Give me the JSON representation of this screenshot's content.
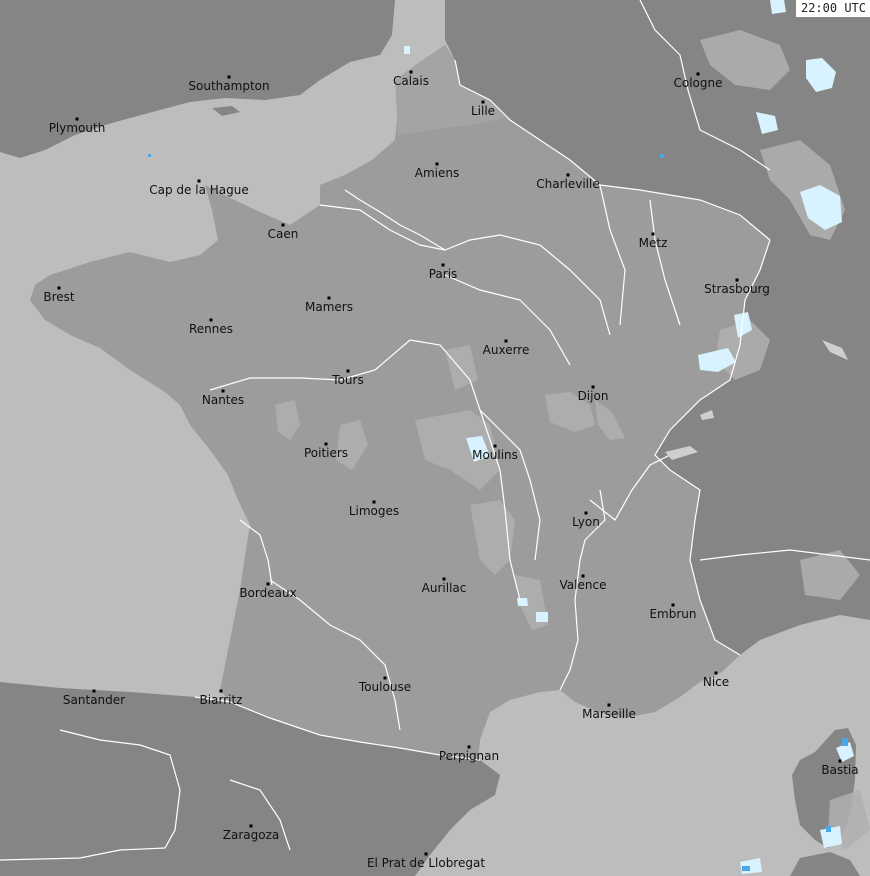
{
  "map": {
    "timestamp": "22:00 UTC",
    "colors": {
      "sea": "#bdbdbd",
      "france": "#9c9c9c",
      "neighbors": "#858585",
      "borders": "#ffffff",
      "cloud_light": "#b0b0b0",
      "precip_light": "#d8f2ff",
      "precip_medium": "#4aa8e8"
    },
    "cities": [
      {
        "name": "Southampton"
      },
      {
        "name": "Calais"
      },
      {
        "name": "Cologne"
      },
      {
        "name": "Plymouth"
      },
      {
        "name": "Lille"
      },
      {
        "name": "Cap de la Hague"
      },
      {
        "name": "Amiens"
      },
      {
        "name": "Charleville"
      },
      {
        "name": "Caen"
      },
      {
        "name": "Metz"
      },
      {
        "name": "Paris"
      },
      {
        "name": "Brest"
      },
      {
        "name": "Strasbourg"
      },
      {
        "name": "Mamers"
      },
      {
        "name": "Rennes"
      },
      {
        "name": "Auxerre"
      },
      {
        "name": "Tours"
      },
      {
        "name": "Dijon"
      },
      {
        "name": "Nantes"
      },
      {
        "name": "Poitiers"
      },
      {
        "name": "Moulins"
      },
      {
        "name": "Limoges"
      },
      {
        "name": "Lyon"
      },
      {
        "name": "Aurillac"
      },
      {
        "name": "Valence"
      },
      {
        "name": "Bordeaux"
      },
      {
        "name": "Embrun"
      },
      {
        "name": "Nice"
      },
      {
        "name": "Toulouse"
      },
      {
        "name": "Santander"
      },
      {
        "name": "Biarritz"
      },
      {
        "name": "Marseille"
      },
      {
        "name": "Perpignan"
      },
      {
        "name": "Bastia"
      },
      {
        "name": "Zaragoza"
      },
      {
        "name": "El Prat de Llobregat"
      }
    ]
  }
}
